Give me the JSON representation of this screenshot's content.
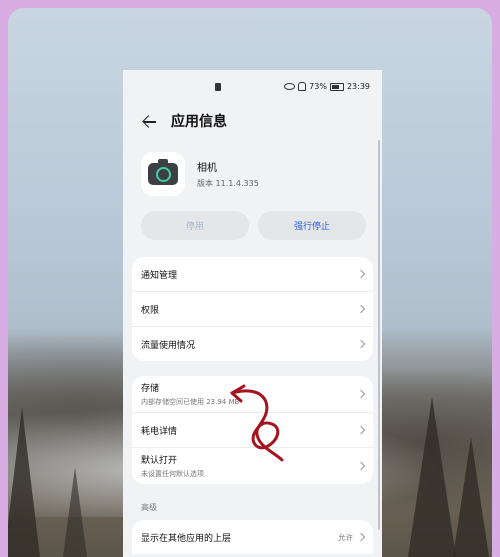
{
  "status_bar": {
    "time": "23:39",
    "battery": "73%"
  },
  "header": {
    "title": "应用信息"
  },
  "app": {
    "name": "相机",
    "version": "版本 11.1.4.335"
  },
  "buttons": {
    "disable": "停用",
    "force_stop": "强行停止"
  },
  "group1": [
    {
      "label": "通知管理"
    },
    {
      "label": "权限"
    },
    {
      "label": "流量使用情况"
    }
  ],
  "group2": [
    {
      "label": "存储",
      "sub": "内部存储空间已使用 23.94 MB"
    },
    {
      "label": "耗电详情"
    },
    {
      "label": "默认打开",
      "sub": "未设置任何默认选项"
    }
  ],
  "advanced": {
    "section_title": "高级",
    "items": [
      {
        "label": "显示在其他应用的上层",
        "value": "允许"
      }
    ]
  },
  "colors": {
    "accent": "#2b5fd9",
    "annotation": "#a3141f",
    "frame": "#d7ade4"
  }
}
